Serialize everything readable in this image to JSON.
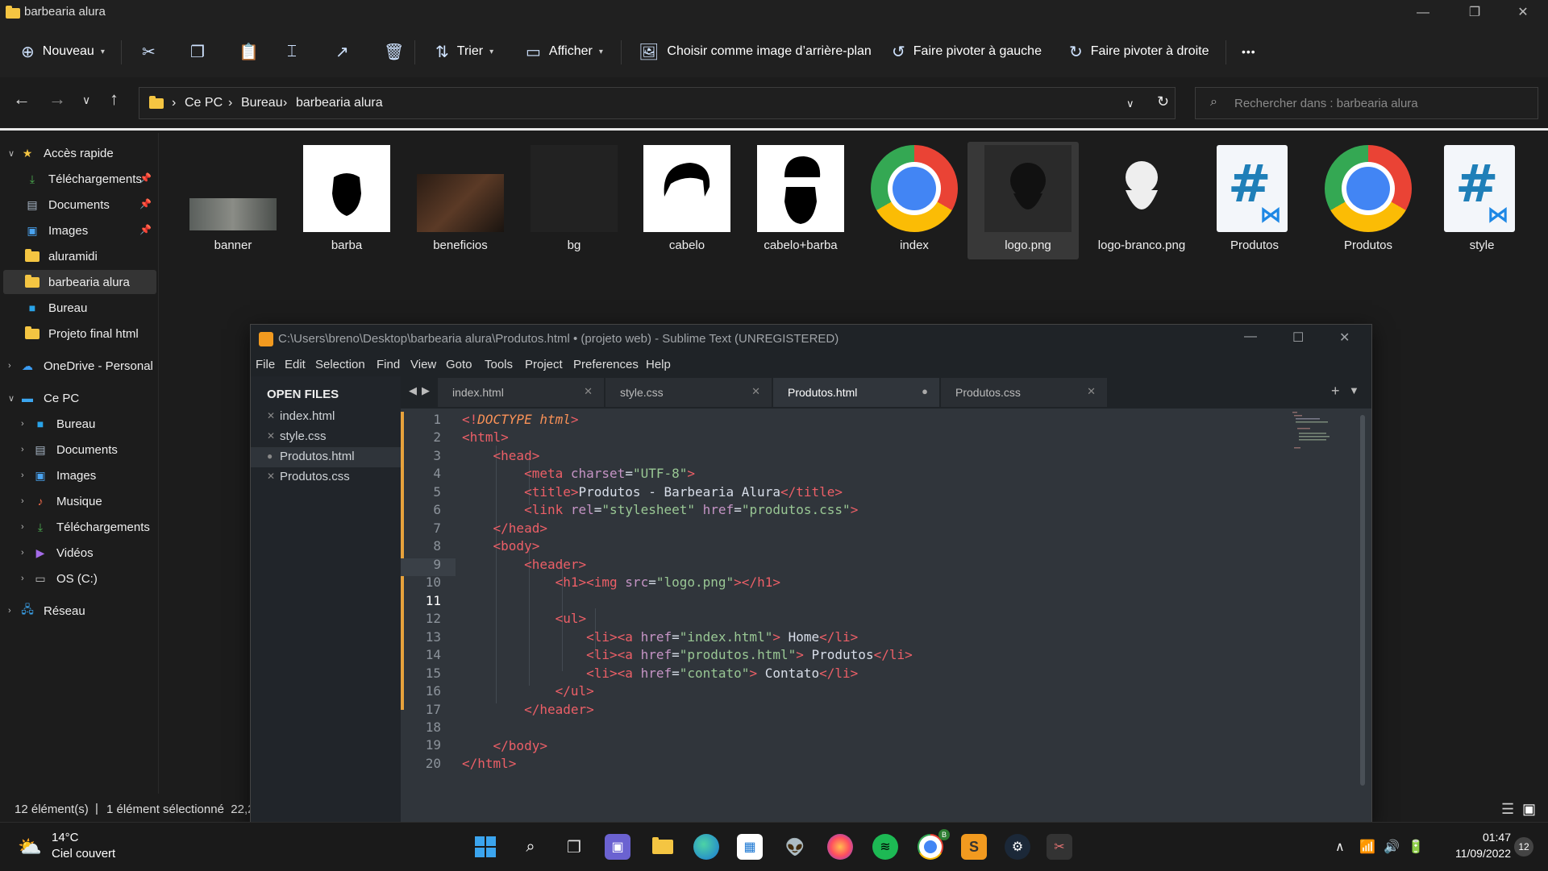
{
  "explorer": {
    "window_title": "barbearia alura",
    "toolbar": {
      "new_label": "Nouveau",
      "sort_label": "Trier",
      "view_label": "Afficher",
      "set_bg_label": "Choisir comme image d’arrière-plan",
      "rotate_left_label": "Faire pivoter à gauche",
      "rotate_right_label": "Faire pivoter à droite",
      "more_label": "•••"
    },
    "address": {
      "crumbs": [
        "Ce PC",
        "Bureau",
        "barbearia alura"
      ],
      "search_placeholder": "Rechercher dans : barbearia alura"
    },
    "sidebar": {
      "items": [
        {
          "label": "Accès rapide",
          "icon": "star-icon"
        },
        {
          "label": "Téléchargements",
          "icon": "download-icon"
        },
        {
          "label": "Documents",
          "icon": "document-icon"
        },
        {
          "label": "Images",
          "icon": "image-icon"
        },
        {
          "label": "aluramidi",
          "icon": "folder-icon"
        },
        {
          "label": "barbearia alura",
          "icon": "folder-icon"
        },
        {
          "label": "Bureau",
          "icon": "desktop-icon"
        },
        {
          "label": "Projeto final html",
          "icon": "folder-icon"
        },
        {
          "label": "OneDrive - Personal",
          "icon": "cloud-icon"
        },
        {
          "label": "Ce PC",
          "icon": "pc-icon"
        },
        {
          "label": "Bureau",
          "icon": "desktop-icon"
        },
        {
          "label": "Documents",
          "icon": "document-icon"
        },
        {
          "label": "Images",
          "icon": "image-icon"
        },
        {
          "label": "Musique",
          "icon": "music-icon"
        },
        {
          "label": "Téléchargements",
          "icon": "download-icon"
        },
        {
          "label": "Vidéos",
          "icon": "video-icon"
        },
        {
          "label": "OS (C:)",
          "icon": "drive-icon"
        },
        {
          "label": "Réseau",
          "icon": "network-icon"
        }
      ]
    },
    "files": [
      {
        "name": "banner"
      },
      {
        "name": "barba"
      },
      {
        "name": "beneficios"
      },
      {
        "name": "bg"
      },
      {
        "name": "cabelo"
      },
      {
        "name": "cabelo+barba"
      },
      {
        "name": "index"
      },
      {
        "name": "logo.png"
      },
      {
        "name": "logo-branco.png"
      },
      {
        "name": "Produtos"
      },
      {
        "name": "Produtos"
      },
      {
        "name": "style"
      }
    ],
    "status": {
      "count": "12 élément(s)",
      "selected": "1 élément sélectionné  22,2"
    }
  },
  "sublime": {
    "title": "C:\\Users\\breno\\Desktop\\barbearia alura\\Produtos.html • (projeto web) - Sublime Text (UNREGISTERED)",
    "menu": [
      "File",
      "Edit",
      "Selection",
      "Find",
      "View",
      "Goto",
      "Tools",
      "Project",
      "Preferences",
      "Help"
    ],
    "open_files_header": "OPEN FILES",
    "open_files": [
      "index.html",
      "style.css",
      "Produtos.html",
      "Produtos.css"
    ],
    "tabs": [
      "index.html",
      "style.css",
      "Produtos.html",
      "Produtos.css"
    ],
    "active_tab": "Produtos.html",
    "current_line": 11,
    "line_numbers": [
      "1",
      "2",
      "3",
      "4",
      "5",
      "6",
      "7",
      "8",
      "9",
      "10",
      "11",
      "12",
      "13",
      "14",
      "15",
      "16",
      "17",
      "18",
      "19",
      "20"
    ]
  },
  "taskbar": {
    "weather_temp": "14°C",
    "weather_desc": "Ciel couvert",
    "time": "01:47",
    "date": "11/09/2022",
    "notifications": "12",
    "chrome_badge": "B"
  },
  "colors": {
    "accent_changed": "#e7a23c",
    "tag": "#ec5f67",
    "attr": "#c594c5",
    "string": "#99c794"
  }
}
